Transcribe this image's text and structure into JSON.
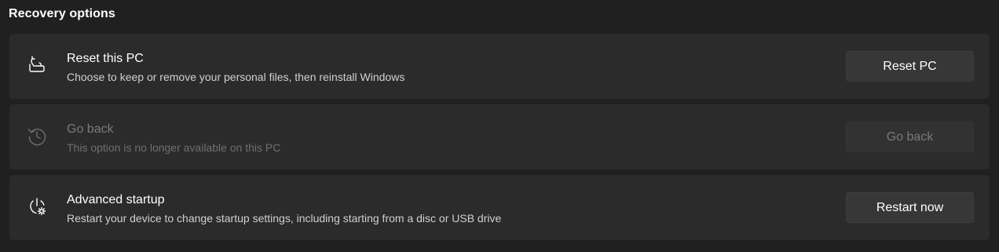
{
  "section": {
    "title": "Recovery options"
  },
  "options": [
    {
      "title": "Reset this PC",
      "description": "Choose to keep or remove your personal files, then reinstall Windows",
      "button_label": "Reset PC",
      "icon": "reset-pc-icon",
      "enabled": true
    },
    {
      "title": "Go back",
      "description": "This option is no longer available on this PC",
      "button_label": "Go back",
      "icon": "history-icon",
      "enabled": false
    },
    {
      "title": "Advanced startup",
      "description": "Restart your device to change startup settings, including starting from a disc or USB drive",
      "button_label": "Restart now",
      "icon": "advanced-startup-icon",
      "enabled": true
    }
  ],
  "colors": {
    "background": "#202020",
    "card": "#2b2b2b",
    "button": "#373737",
    "text": "#ffffff",
    "disabled_text": "#7a7a7a"
  }
}
